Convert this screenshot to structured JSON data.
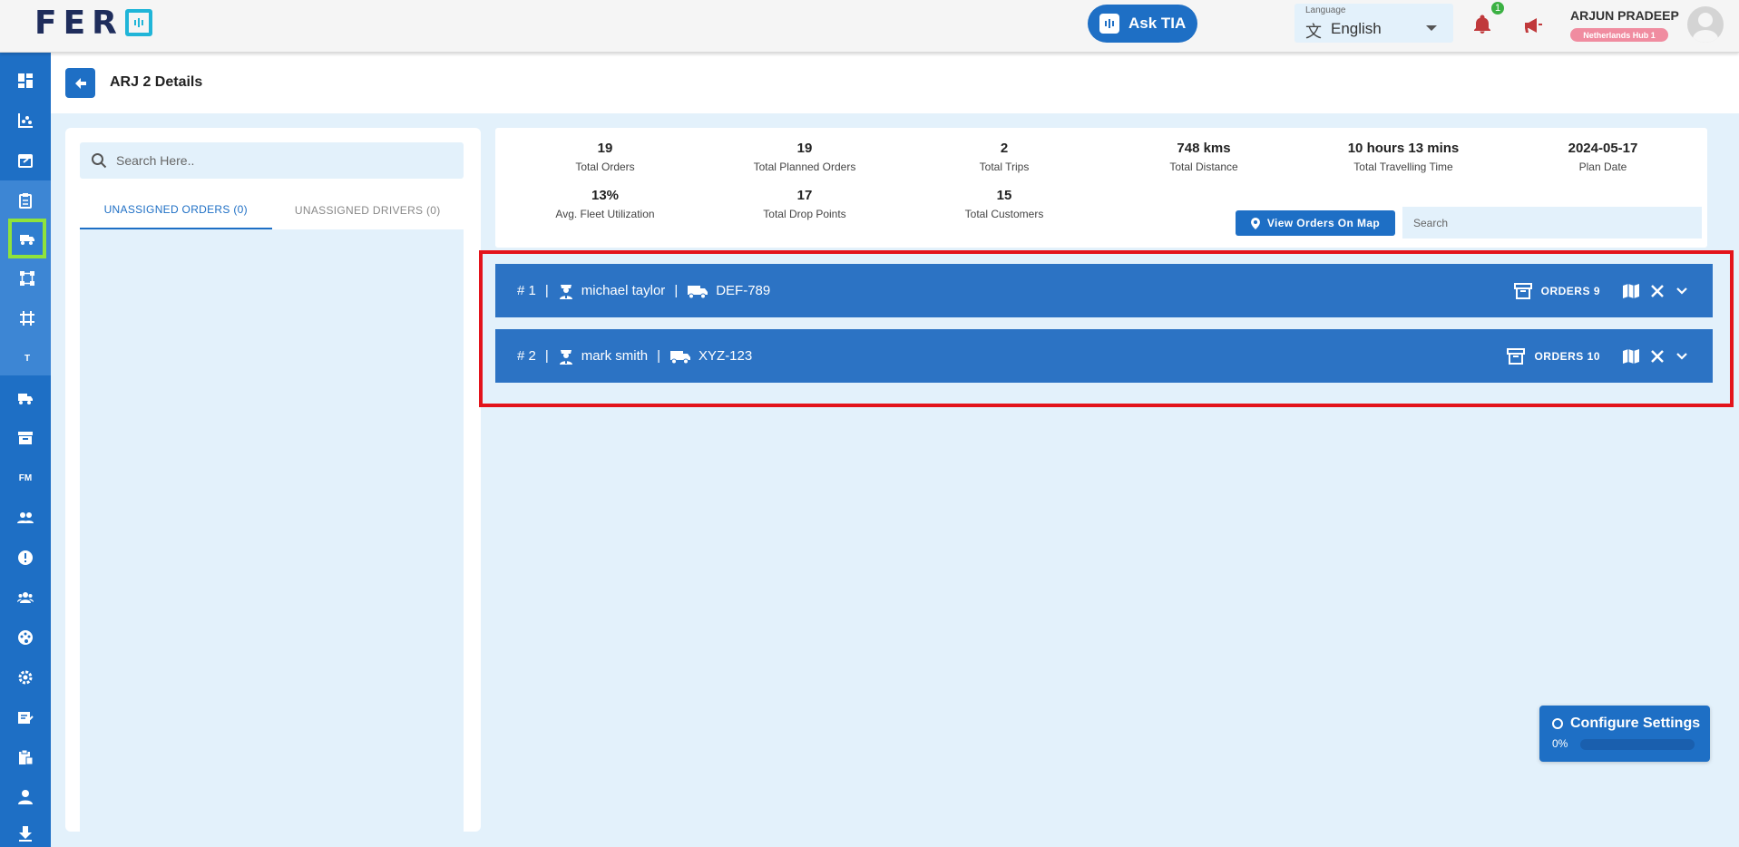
{
  "header": {
    "logo_text": "FER",
    "ask_tia_label": "Ask TIA",
    "language": {
      "label": "Language",
      "value": "English"
    },
    "notification_count": "1",
    "user": {
      "name": "ARJUN PRADEEP",
      "hub": "Netherlands Hub 1"
    }
  },
  "sidebar": {
    "items": [
      {
        "icon": "dashboard-icon"
      },
      {
        "icon": "analytics-icon"
      },
      {
        "icon": "calendar-icon"
      },
      {
        "icon": "clipboard-icon"
      },
      {
        "icon": "trip-planner-icon",
        "active": true
      },
      {
        "icon": "network-icon"
      },
      {
        "icon": "grid-icon"
      },
      {
        "icon": "text-icon",
        "text": "T"
      },
      {
        "icon": "truck-icon"
      },
      {
        "icon": "archive-icon"
      },
      {
        "icon": "fm-icon",
        "text": "FM"
      },
      {
        "icon": "users-icon"
      },
      {
        "icon": "info-icon"
      },
      {
        "icon": "group-icon"
      },
      {
        "icon": "palette-icon"
      },
      {
        "icon": "settings-icon"
      },
      {
        "icon": "edit-note-icon"
      },
      {
        "icon": "clipboard-list-icon"
      },
      {
        "icon": "person-icon"
      },
      {
        "icon": "download-icon"
      }
    ]
  },
  "page": {
    "title": "ARJ 2 Details"
  },
  "left_panel": {
    "search_placeholder": "Search Here..",
    "tabs": [
      {
        "label": "UNASSIGNED ORDERS (0)",
        "active": true
      },
      {
        "label": "UNASSIGNED DRIVERS (0)",
        "active": false
      }
    ]
  },
  "stats": [
    {
      "value": "19",
      "label": "Total Orders"
    },
    {
      "value": "19",
      "label": "Total Planned Orders"
    },
    {
      "value": "2",
      "label": "Total Trips"
    },
    {
      "value": "748 kms",
      "label": "Total Distance"
    },
    {
      "value": "10 hours 13 mins",
      "label": "Total Travelling Time"
    },
    {
      "value": "2024-05-17",
      "label": "Plan Date"
    },
    {
      "value": "13%",
      "label": "Avg. Fleet Utilization"
    },
    {
      "value": "17",
      "label": "Total Drop Points"
    },
    {
      "value": "15",
      "label": "Total Customers"
    }
  ],
  "map_button_label": "View Orders On Map",
  "stats_search_placeholder": "Search",
  "trips": [
    {
      "number": "# 1",
      "driver": "michael taylor",
      "vehicle": "DEF-789",
      "orders_label": "ORDERS 9"
    },
    {
      "number": "# 2",
      "driver": "mark smith",
      "vehicle": "XYZ-123",
      "orders_label": "ORDERS 10"
    }
  ],
  "separator": "|",
  "configure": {
    "title": "Configure Settings",
    "percent_label": "0%",
    "progress": 0
  },
  "colors": {
    "primary": "#1e6fc5",
    "trip_row": "#2c73c4",
    "highlight_box": "#e3131b",
    "active_sidebar_border": "#8fe33b",
    "background": "#e3f1fb"
  }
}
